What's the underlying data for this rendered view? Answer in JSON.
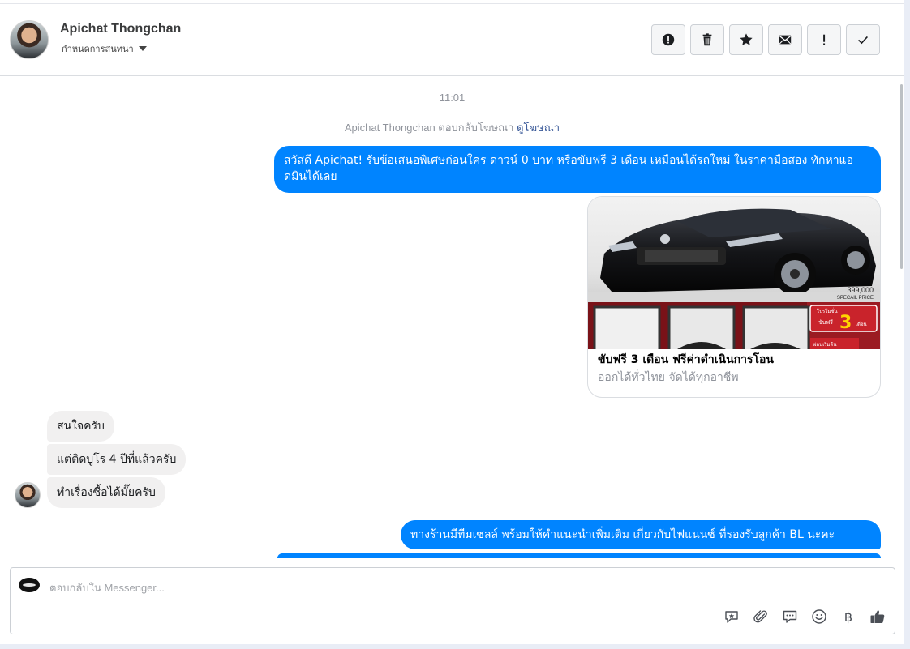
{
  "header": {
    "contact_name": "Apichat Thongchan",
    "assign_label": "กำหนดการสนทนา",
    "actions": [
      {
        "name": "spam-report",
        "icon": "alert-circle-icon"
      },
      {
        "name": "delete",
        "icon": "trash-icon"
      },
      {
        "name": "star",
        "icon": "star-icon"
      },
      {
        "name": "mark-unread",
        "icon": "envelope-icon"
      },
      {
        "name": "flag-important",
        "icon": "exclamation-icon"
      },
      {
        "name": "mark-done",
        "icon": "check-icon"
      }
    ]
  },
  "conversation": {
    "timestamp": "11:01",
    "ad_reply_note": "Apichat Thongchan ตอบกลับโฆษณา",
    "ad_link_label": "ดูโฆษณา",
    "messages": {
      "out_1": "สวัสดี Apichat! รับข้อเสนอพิเศษก่อนใคร ดาวน์ 0 บาท หรือขับฟรี 3 เดือน เหมือนได้รถใหม่ ในราคามือสอง ทักหาแอดมินได้เลย",
      "card_title": "ขับฟรี 3 เดือน ฟรีค่าดำเนินการโอน",
      "card_subtitle": "ออกได้ทั่วไทย จัดได้ทุกอาชีพ",
      "card_price": "399,000",
      "card_price_caption": "SPECAIL PRICE",
      "card_promo_top": "โปรโมชั่น",
      "card_promo_free": "ขับฟรี",
      "card_promo_number": "3",
      "card_promo_unit": "เดือน",
      "card_promo_bottom": "ผ่อนเริ่มต้น",
      "in_1": "สนใจครับ",
      "in_2": "แต่ติดบูโร 4 ปีที่แล้วครับ",
      "in_3": "ทำเรื่องซื้อได้มั๊ยครับ",
      "out_2": "ทางร้านมีทีมเซลล์ พร้อมให้คำแนะนำเพิ่มเติม เกี่ยวกับไฟแนนซ์ ที่รองรับลูกค้า BL นะคะ"
    }
  },
  "composer": {
    "placeholder": "ตอบกลับใน Messenger...",
    "tools": [
      "sticker-icon",
      "attachment-icon",
      "saved-replies-icon",
      "emoji-icon",
      "baht-icon",
      "like-icon"
    ],
    "baht_symbol": "฿"
  },
  "colors": {
    "outgoing_bubble": "#0084ff",
    "incoming_bubble": "#f1f0f0",
    "link": "#385898"
  }
}
